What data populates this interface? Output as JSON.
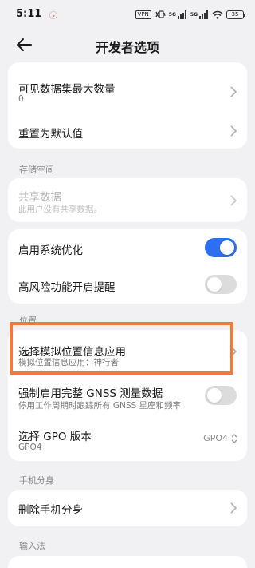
{
  "status_bar": {
    "time": "5:11",
    "message_icon_text": "ⓢ",
    "vpn": "VPN",
    "net_tag_1": "5G",
    "net_tag_2": "5G",
    "battery": "35"
  },
  "header": {
    "title": "开发者选项"
  },
  "card_top": {
    "max_visible_datasets": {
      "title": "可见数据集最大数量",
      "value": "0"
    },
    "reset_default": {
      "title": "重置为默认值"
    }
  },
  "storage": {
    "section_label": "存储空间",
    "shared_data": {
      "title": "共享数据",
      "subtitle": "此用户没有共享数据。"
    }
  },
  "system": {
    "enable_optimization": {
      "title": "启用系统优化",
      "on": true
    },
    "high_risk_prompt": {
      "title": "高风险功能开启提醒",
      "on": false
    }
  },
  "location": {
    "section_label": "位置",
    "mock_location_app": {
      "title": "选择模拟位置信息应用",
      "subtitle": "模拟位置信息应用：神行者"
    },
    "force_gnss": {
      "title": "强制启用完整 GNSS 测量数据",
      "subtitle": "停用工作周期时跟踪所有 GNSS 星座和频率",
      "on": false
    },
    "gpo_version": {
      "title": "选择 GPO 版本",
      "subtitle": "GPO4",
      "value": "GPO4"
    }
  },
  "clone": {
    "section_label": "手机分身",
    "delete_clone": {
      "title": "删除手机分身"
    }
  },
  "input": {
    "section_label": "输入法",
    "partial_item": "..."
  },
  "colors": {
    "accent": "#2e6ef0",
    "highlight": "#f07a3a",
    "background": "#f1f1f3"
  }
}
